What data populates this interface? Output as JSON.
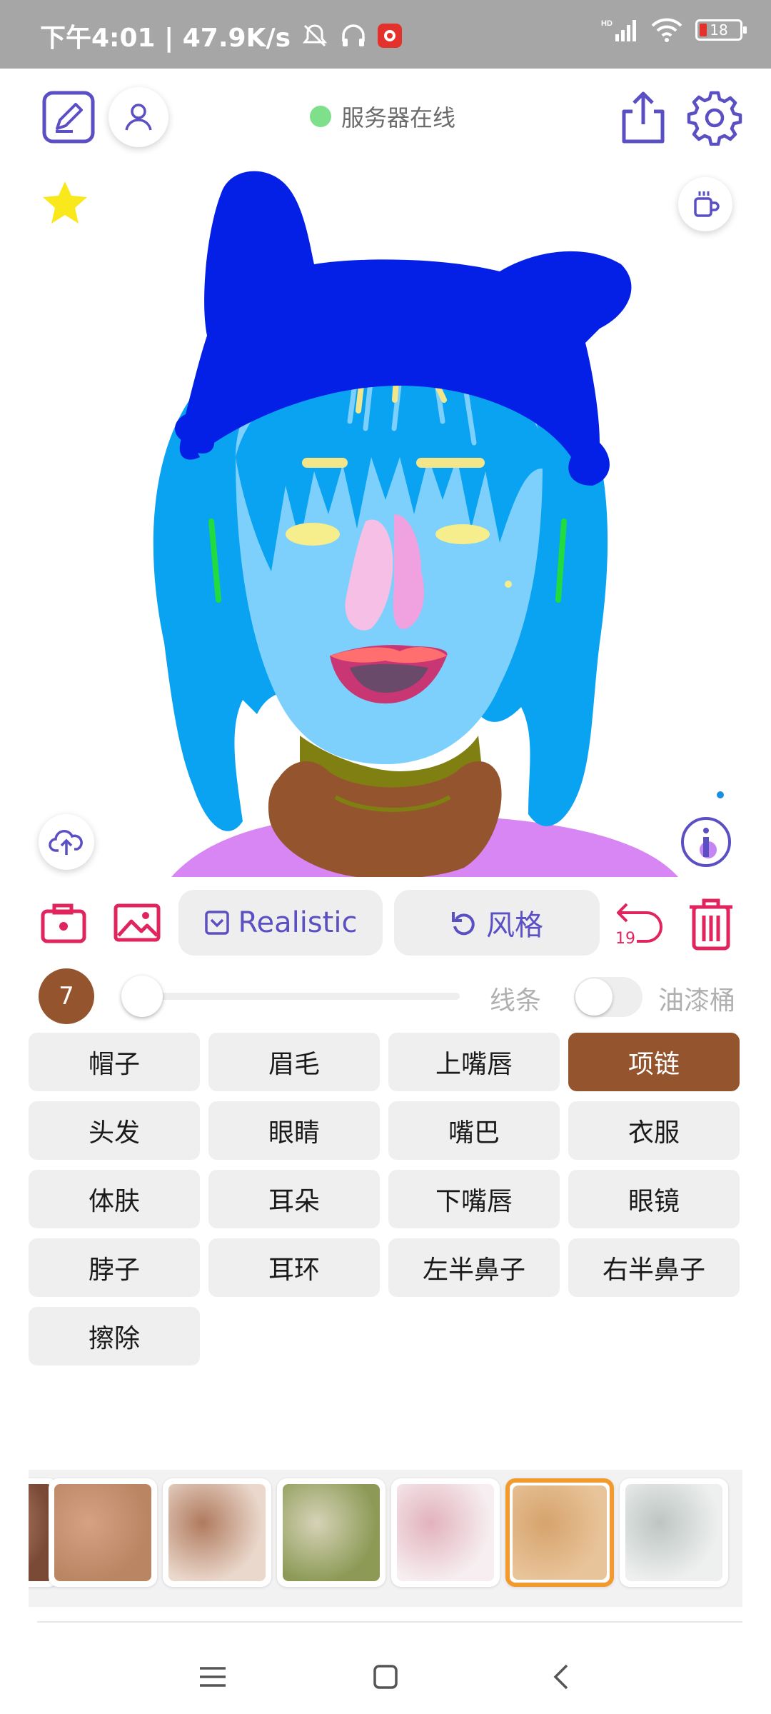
{
  "status_bar": {
    "time_net": "下午4:01 | 47.9K/s",
    "battery": "18"
  },
  "toolbar": {
    "server_status": "服务器在线"
  },
  "actions": {
    "realistic_label": "Realistic",
    "style_label": "风格",
    "undo_count": "19"
  },
  "brush": {
    "size": "7",
    "slider_fraction": 0.05,
    "line_label": "线条",
    "bucket_label": "油漆桶",
    "bucket_enabled": false
  },
  "parts": [
    {
      "label": "帽子"
    },
    {
      "label": "眉毛"
    },
    {
      "label": "上嘴唇"
    },
    {
      "label": "项链",
      "active": true
    },
    {
      "label": "头发"
    },
    {
      "label": "眼睛"
    },
    {
      "label": "嘴巴"
    },
    {
      "label": "衣服"
    },
    {
      "label": "体肤"
    },
    {
      "label": "耳朵"
    },
    {
      "label": "下嘴唇"
    },
    {
      "label": "眼镜"
    },
    {
      "label": "脖子"
    },
    {
      "label": "耳环"
    },
    {
      "label": "左半鼻子"
    },
    {
      "label": "右半鼻子"
    },
    {
      "label": "擦除"
    }
  ],
  "colors": {
    "accent": "#5b4fc4",
    "danger": "#e0245e",
    "selected_part": "#93542e",
    "selected_thumb": "#f29a2e",
    "server_online": "#7ee08a"
  },
  "style_thumbnails": [
    {
      "name": "partial-texture",
      "colors": [
        "#7a4a36",
        "#c98f78"
      ]
    },
    {
      "name": "skin-texture",
      "colors": [
        "#b98562",
        "#d6a184"
      ]
    },
    {
      "name": "pale-skin-texture",
      "colors": [
        "#ead8cc",
        "#b07a5e"
      ]
    },
    {
      "name": "moss-texture",
      "colors": [
        "#8c9a56",
        "#d6d3b7"
      ]
    },
    {
      "name": "pink-white-texture",
      "colors": [
        "#f6eef0",
        "#e2b2bd"
      ]
    },
    {
      "name": "wood-texture",
      "colors": [
        "#e8c49a",
        "#d6a36c"
      ],
      "selected": true
    },
    {
      "name": "grey-white-texture",
      "colors": [
        "#eef0ef",
        "#bdc5c2"
      ]
    }
  ]
}
